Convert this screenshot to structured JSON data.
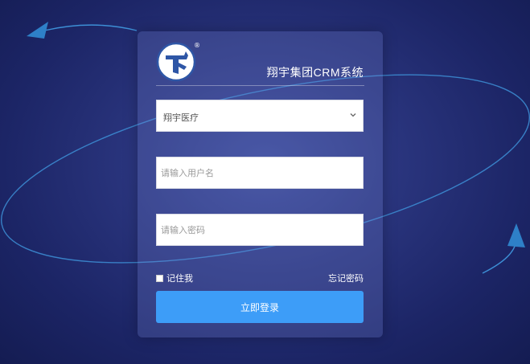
{
  "brand": {
    "title": "翔宇集团CRM系统",
    "registered_mark": "®"
  },
  "form": {
    "company_select": {
      "value": "翔宇医疗"
    },
    "username": {
      "placeholder": "请输入用户名",
      "value": ""
    },
    "password": {
      "placeholder": "请输入密码",
      "value": ""
    },
    "remember_label": "记住我",
    "forgot_label": "忘记密码",
    "submit_label": "立即登录"
  },
  "colors": {
    "background_dark": "#1c2566",
    "background_light": "#3b4a9a",
    "accent_button": "#3d9df8",
    "orbit_arrow": "#2e80c8"
  },
  "icons": {
    "logo": "cross-logo-icon",
    "select_arrow": "chevron-down-icon",
    "decor_arrows": "arrow-icon"
  }
}
